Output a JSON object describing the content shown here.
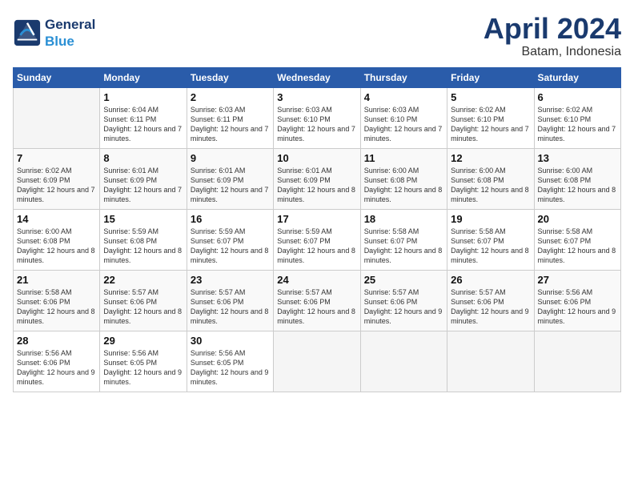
{
  "header": {
    "logo_general": "General",
    "logo_blue": "Blue",
    "month": "April 2024",
    "location": "Batam, Indonesia"
  },
  "days_of_week": [
    "Sunday",
    "Monday",
    "Tuesday",
    "Wednesday",
    "Thursday",
    "Friday",
    "Saturday"
  ],
  "weeks": [
    [
      {
        "num": "",
        "sunrise": "",
        "sunset": "",
        "daylight": ""
      },
      {
        "num": "1",
        "sunrise": "Sunrise: 6:04 AM",
        "sunset": "Sunset: 6:11 PM",
        "daylight": "Daylight: 12 hours and 7 minutes."
      },
      {
        "num": "2",
        "sunrise": "Sunrise: 6:03 AM",
        "sunset": "Sunset: 6:11 PM",
        "daylight": "Daylight: 12 hours and 7 minutes."
      },
      {
        "num": "3",
        "sunrise": "Sunrise: 6:03 AM",
        "sunset": "Sunset: 6:10 PM",
        "daylight": "Daylight: 12 hours and 7 minutes."
      },
      {
        "num": "4",
        "sunrise": "Sunrise: 6:03 AM",
        "sunset": "Sunset: 6:10 PM",
        "daylight": "Daylight: 12 hours and 7 minutes."
      },
      {
        "num": "5",
        "sunrise": "Sunrise: 6:02 AM",
        "sunset": "Sunset: 6:10 PM",
        "daylight": "Daylight: 12 hours and 7 minutes."
      },
      {
        "num": "6",
        "sunrise": "Sunrise: 6:02 AM",
        "sunset": "Sunset: 6:10 PM",
        "daylight": "Daylight: 12 hours and 7 minutes."
      }
    ],
    [
      {
        "num": "7",
        "sunrise": "Sunrise: 6:02 AM",
        "sunset": "Sunset: 6:09 PM",
        "daylight": "Daylight: 12 hours and 7 minutes."
      },
      {
        "num": "8",
        "sunrise": "Sunrise: 6:01 AM",
        "sunset": "Sunset: 6:09 PM",
        "daylight": "Daylight: 12 hours and 7 minutes."
      },
      {
        "num": "9",
        "sunrise": "Sunrise: 6:01 AM",
        "sunset": "Sunset: 6:09 PM",
        "daylight": "Daylight: 12 hours and 7 minutes."
      },
      {
        "num": "10",
        "sunrise": "Sunrise: 6:01 AM",
        "sunset": "Sunset: 6:09 PM",
        "daylight": "Daylight: 12 hours and 8 minutes."
      },
      {
        "num": "11",
        "sunrise": "Sunrise: 6:00 AM",
        "sunset": "Sunset: 6:08 PM",
        "daylight": "Daylight: 12 hours and 8 minutes."
      },
      {
        "num": "12",
        "sunrise": "Sunrise: 6:00 AM",
        "sunset": "Sunset: 6:08 PM",
        "daylight": "Daylight: 12 hours and 8 minutes."
      },
      {
        "num": "13",
        "sunrise": "Sunrise: 6:00 AM",
        "sunset": "Sunset: 6:08 PM",
        "daylight": "Daylight: 12 hours and 8 minutes."
      }
    ],
    [
      {
        "num": "14",
        "sunrise": "Sunrise: 6:00 AM",
        "sunset": "Sunset: 6:08 PM",
        "daylight": "Daylight: 12 hours and 8 minutes."
      },
      {
        "num": "15",
        "sunrise": "Sunrise: 5:59 AM",
        "sunset": "Sunset: 6:08 PM",
        "daylight": "Daylight: 12 hours and 8 minutes."
      },
      {
        "num": "16",
        "sunrise": "Sunrise: 5:59 AM",
        "sunset": "Sunset: 6:07 PM",
        "daylight": "Daylight: 12 hours and 8 minutes."
      },
      {
        "num": "17",
        "sunrise": "Sunrise: 5:59 AM",
        "sunset": "Sunset: 6:07 PM",
        "daylight": "Daylight: 12 hours and 8 minutes."
      },
      {
        "num": "18",
        "sunrise": "Sunrise: 5:58 AM",
        "sunset": "Sunset: 6:07 PM",
        "daylight": "Daylight: 12 hours and 8 minutes."
      },
      {
        "num": "19",
        "sunrise": "Sunrise: 5:58 AM",
        "sunset": "Sunset: 6:07 PM",
        "daylight": "Daylight: 12 hours and 8 minutes."
      },
      {
        "num": "20",
        "sunrise": "Sunrise: 5:58 AM",
        "sunset": "Sunset: 6:07 PM",
        "daylight": "Daylight: 12 hours and 8 minutes."
      }
    ],
    [
      {
        "num": "21",
        "sunrise": "Sunrise: 5:58 AM",
        "sunset": "Sunset: 6:06 PM",
        "daylight": "Daylight: 12 hours and 8 minutes."
      },
      {
        "num": "22",
        "sunrise": "Sunrise: 5:57 AM",
        "sunset": "Sunset: 6:06 PM",
        "daylight": "Daylight: 12 hours and 8 minutes."
      },
      {
        "num": "23",
        "sunrise": "Sunrise: 5:57 AM",
        "sunset": "Sunset: 6:06 PM",
        "daylight": "Daylight: 12 hours and 8 minutes."
      },
      {
        "num": "24",
        "sunrise": "Sunrise: 5:57 AM",
        "sunset": "Sunset: 6:06 PM",
        "daylight": "Daylight: 12 hours and 8 minutes."
      },
      {
        "num": "25",
        "sunrise": "Sunrise: 5:57 AM",
        "sunset": "Sunset: 6:06 PM",
        "daylight": "Daylight: 12 hours and 9 minutes."
      },
      {
        "num": "26",
        "sunrise": "Sunrise: 5:57 AM",
        "sunset": "Sunset: 6:06 PM",
        "daylight": "Daylight: 12 hours and 9 minutes."
      },
      {
        "num": "27",
        "sunrise": "Sunrise: 5:56 AM",
        "sunset": "Sunset: 6:06 PM",
        "daylight": "Daylight: 12 hours and 9 minutes."
      }
    ],
    [
      {
        "num": "28",
        "sunrise": "Sunrise: 5:56 AM",
        "sunset": "Sunset: 6:06 PM",
        "daylight": "Daylight: 12 hours and 9 minutes."
      },
      {
        "num": "29",
        "sunrise": "Sunrise: 5:56 AM",
        "sunset": "Sunset: 6:05 PM",
        "daylight": "Daylight: 12 hours and 9 minutes."
      },
      {
        "num": "30",
        "sunrise": "Sunrise: 5:56 AM",
        "sunset": "Sunset: 6:05 PM",
        "daylight": "Daylight: 12 hours and 9 minutes."
      },
      {
        "num": "",
        "sunrise": "",
        "sunset": "",
        "daylight": ""
      },
      {
        "num": "",
        "sunrise": "",
        "sunset": "",
        "daylight": ""
      },
      {
        "num": "",
        "sunrise": "",
        "sunset": "",
        "daylight": ""
      },
      {
        "num": "",
        "sunrise": "",
        "sunset": "",
        "daylight": ""
      }
    ]
  ]
}
